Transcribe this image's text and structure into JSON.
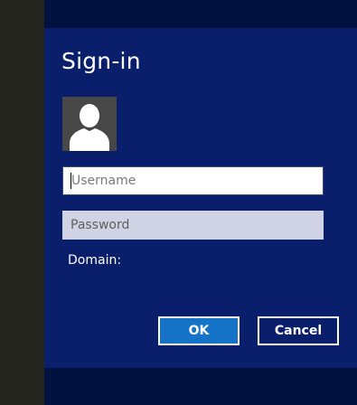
{
  "dialog": {
    "title": "Sign-in",
    "avatar_icon": "user-silhouette-icon",
    "username": {
      "value": "",
      "placeholder": "Username"
    },
    "password": {
      "value": "",
      "placeholder": "Password"
    },
    "domain_label": "Domain:",
    "ok_label": "OK",
    "cancel_label": "Cancel"
  },
  "colors": {
    "dialog_background": "#0a1f6b",
    "page_background": "#021240",
    "left_strip": "#24251f",
    "ok_accent": "#1573c8",
    "avatar_background": "#474747"
  }
}
